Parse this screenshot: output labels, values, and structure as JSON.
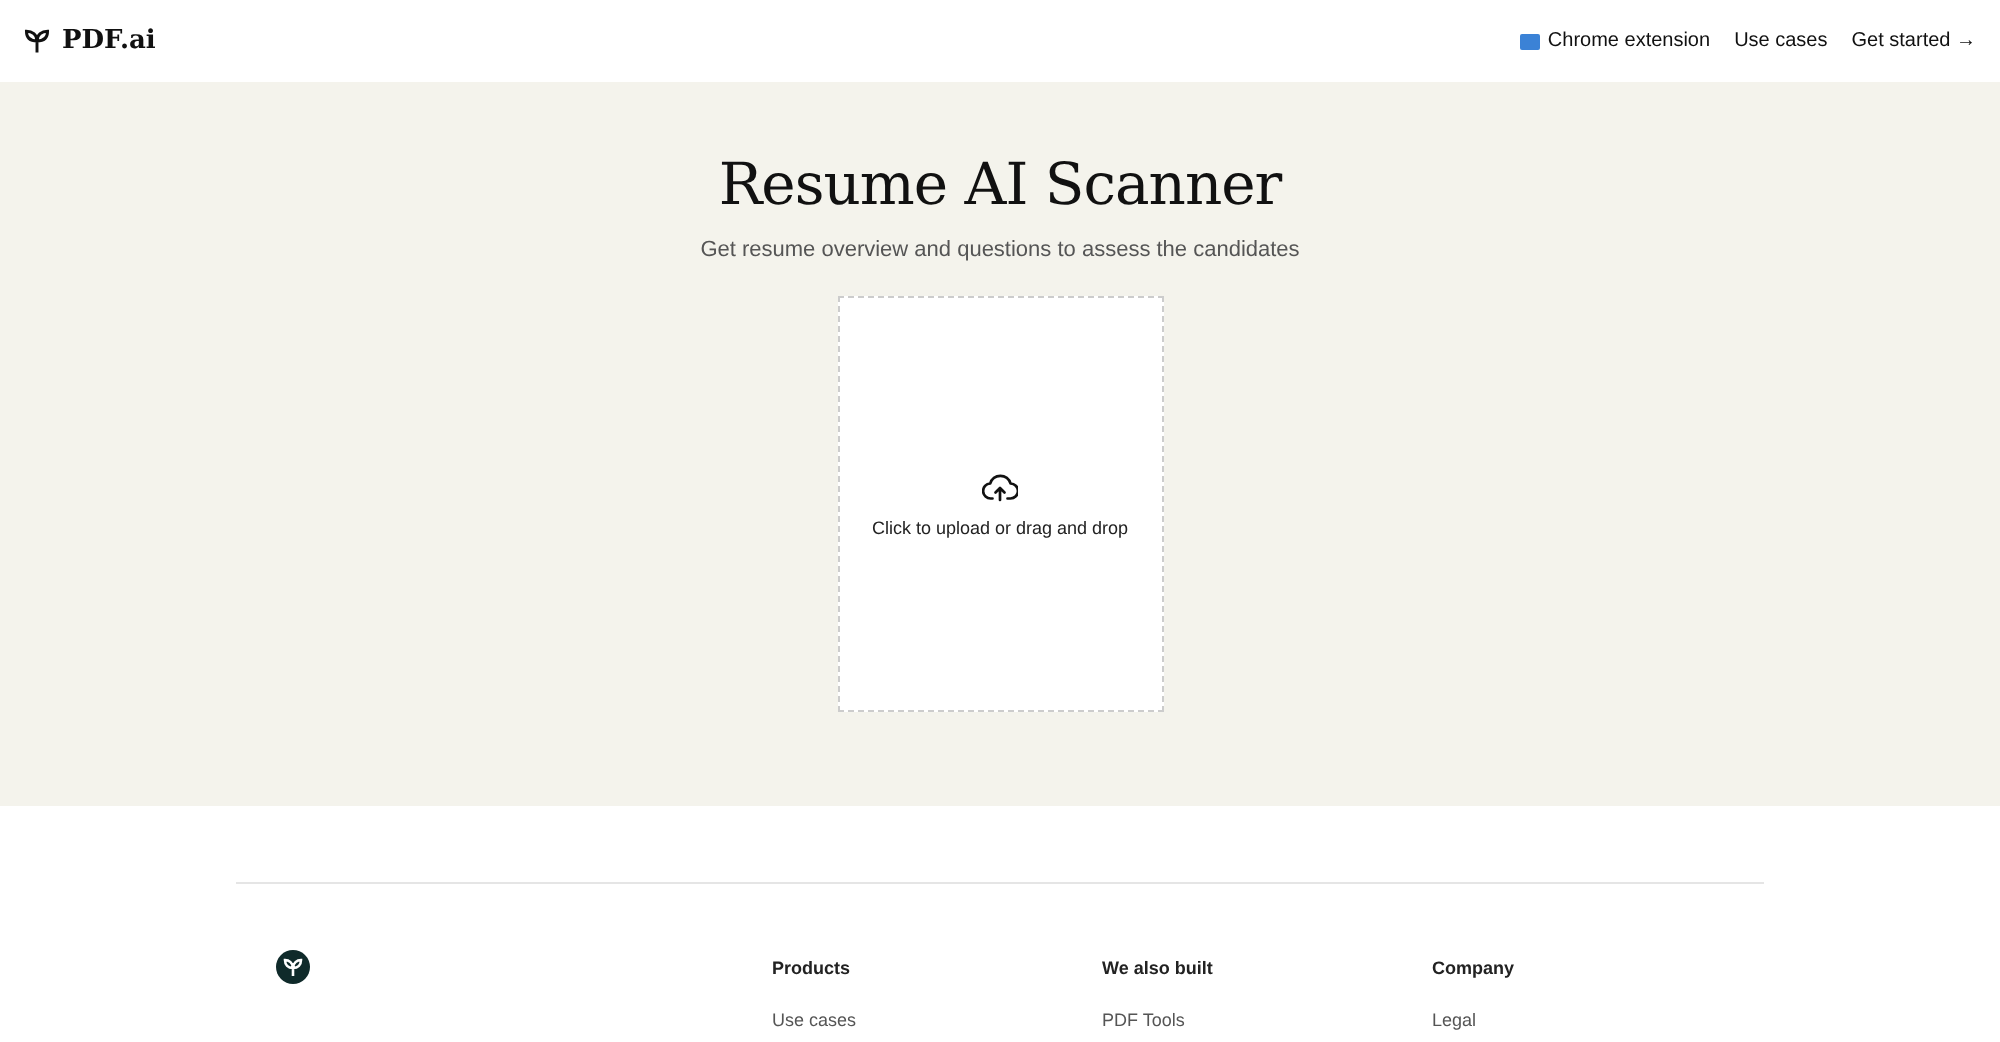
{
  "header": {
    "logo": "PDF.ai",
    "nav": [
      {
        "label": "Chrome extension",
        "kind": "badge"
      },
      {
        "label": "Use cases",
        "kind": "plain"
      },
      {
        "label": "Get started →",
        "kind": "plain"
      }
    ]
  },
  "hero": {
    "title": "Resume AI Scanner",
    "subtitle": "Get resume overview and questions to assess the candidates",
    "dropzone": {
      "label": "Click to upload or drag and drop"
    }
  },
  "footer": {
    "columns": [
      {
        "heading": "Products",
        "links": [
          "Use cases"
        ]
      },
      {
        "heading": "We also built",
        "links": [
          "PDF Tools"
        ]
      },
      {
        "heading": "Company",
        "links": [
          "Legal"
        ]
      }
    ]
  }
}
